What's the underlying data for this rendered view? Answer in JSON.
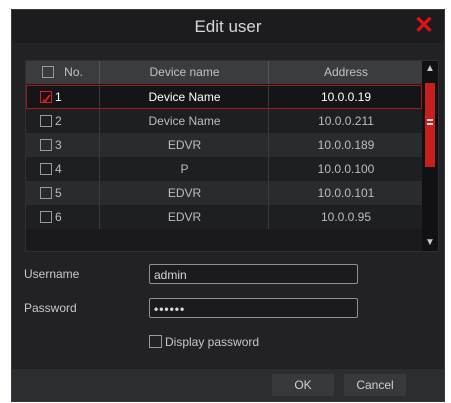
{
  "dialog": {
    "title": "Edit user"
  },
  "table": {
    "headers": {
      "no": "No.",
      "device_name": "Device name",
      "address": "Address"
    },
    "rows": [
      {
        "no": "1",
        "device_name": "Device Name",
        "address": "10.0.0.19",
        "checked": true
      },
      {
        "no": "2",
        "device_name": "Device Name",
        "address": "10.0.0.211",
        "checked": false
      },
      {
        "no": "3",
        "device_name": "EDVR",
        "address": "10.0.0.189",
        "checked": false
      },
      {
        "no": "4",
        "device_name": "P",
        "address": "10.0.0.100",
        "checked": false
      },
      {
        "no": "5",
        "device_name": "EDVR",
        "address": "10.0.0.101",
        "checked": false
      },
      {
        "no": "6",
        "device_name": "EDVR",
        "address": "10.0.0.95",
        "checked": false
      }
    ]
  },
  "form": {
    "username_label": "Username",
    "username_value": "admin",
    "password_label": "Password",
    "password_value": "••••••",
    "display_password_label": "Display password",
    "display_password_checked": false
  },
  "footer": {
    "ok_label": "OK",
    "cancel_label": "Cancel"
  },
  "colors": {
    "accent_red": "#e3101a",
    "dialog_bg": "#222225"
  },
  "icons": {
    "close": "close-icon",
    "scroll_up": "chevron-up-icon",
    "scroll_down": "chevron-down-icon"
  }
}
